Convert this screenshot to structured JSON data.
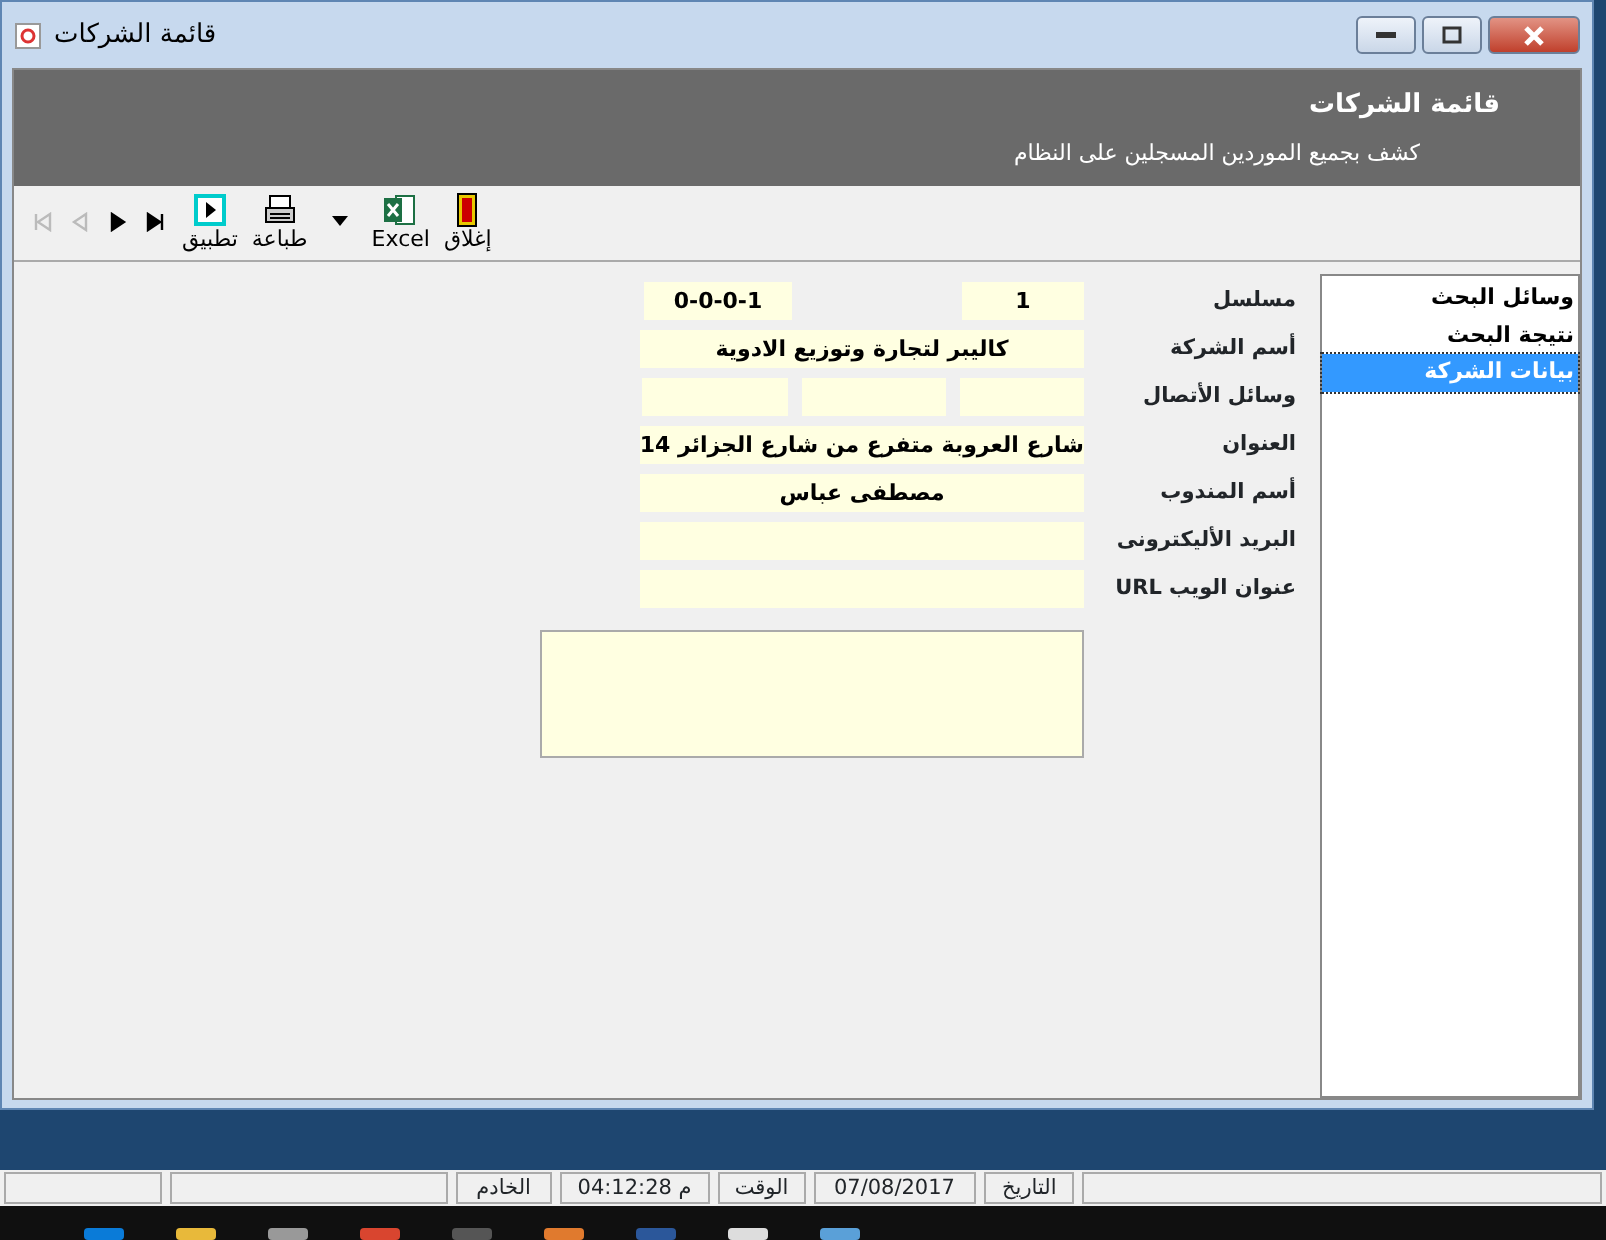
{
  "window": {
    "title": "قائمة الشركات"
  },
  "header": {
    "title": "قائمة الشركات",
    "subtitle": "كشف بجميع الموردين المسجلين على النظام"
  },
  "toolbar": {
    "buttons": [
      {
        "kind": "close",
        "label": "إغلاق"
      },
      {
        "kind": "excel",
        "label": "Excel"
      },
      {
        "kind": "dropdown"
      },
      {
        "kind": "print",
        "label": "طباعة"
      },
      {
        "kind": "apply",
        "label": "تطبيق"
      }
    ],
    "nav": [
      {
        "kind": "last",
        "disabled": false
      },
      {
        "kind": "next",
        "disabled": false
      },
      {
        "kind": "prev",
        "disabled": true
      },
      {
        "kind": "first",
        "disabled": true
      }
    ]
  },
  "sidebar": {
    "items": [
      {
        "label": "وسائل البحث",
        "selected": false
      },
      {
        "label": "نتيجة البحث",
        "selected": false
      },
      {
        "label": "بيانات الشركة",
        "selected": true
      }
    ]
  },
  "form": {
    "rows": [
      {
        "label": "مسلسل",
        "kind": "serial",
        "values": [
          "1",
          "0-0-0-1"
        ]
      },
      {
        "label": "أسم الشركة",
        "kind": "single",
        "values": [
          "كاليبر لتجارة وتوزيع الادوية"
        ]
      },
      {
        "label": "وسائل الأتصال",
        "kind": "triple"
      },
      {
        "label": "العنوان",
        "kind": "single",
        "values": [
          "شارع العروبة متفرع من شارع الجزائر 14"
        ]
      },
      {
        "label": "أسم المندوب",
        "kind": "single",
        "values": [
          "مصطفى عباس"
        ]
      },
      {
        "label": "البريد الأليكترونى",
        "kind": "single"
      },
      {
        "label": "عنوان الويب URL",
        "kind": "single"
      }
    ]
  },
  "status_bar": [
    "التاريخ",
    "07/08/2017",
    "الوقت",
    "م 04:12:28",
    "الخادم"
  ]
}
